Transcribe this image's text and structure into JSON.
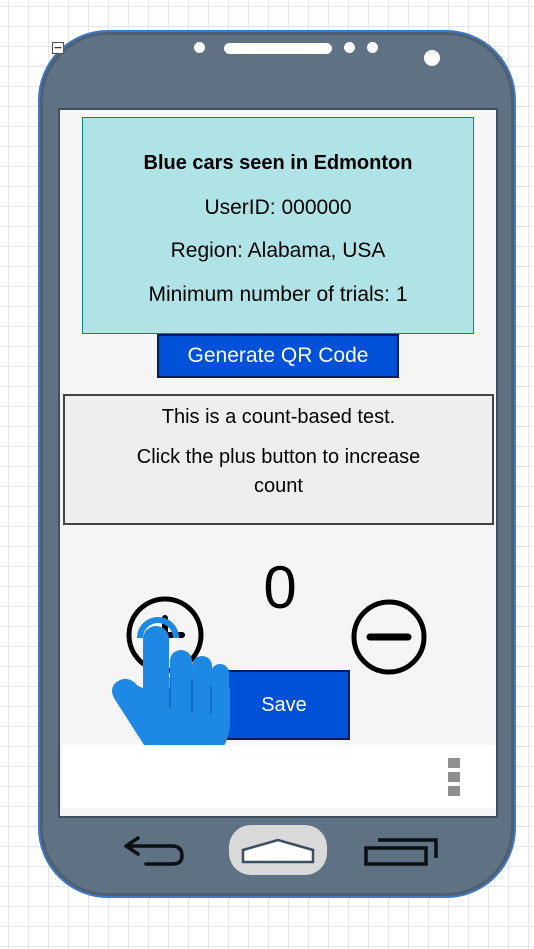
{
  "card": {
    "title": "Blue cars seen in Edmonton",
    "user_id": "UserID: 000000",
    "region": "Region: Alabama, USA",
    "min_trials": "Minimum number of trials: 1"
  },
  "qr_button": {
    "label": "Generate QR Code"
  },
  "instructions": {
    "line1": "This is a count-based test.",
    "line2": "Click the plus button to increase",
    "line3": "count"
  },
  "counter": {
    "value": "0",
    "increment_icon": "plus-circle-icon",
    "decrement_icon": "minus-circle-icon"
  },
  "save_button": {
    "label": "Save"
  },
  "icons": {
    "pointer": "hand-pointer-icon",
    "overflow_menu": "overflow-menu-icon",
    "back": "back-arrow-icon",
    "home": "home-icon",
    "recents": "recent-apps-icon"
  },
  "colors": {
    "phone_body": "#5f7284",
    "card_background": "#b0e3e6",
    "card_border": "#0e8088",
    "button_blue": "#0050d8",
    "hand_blue": "#1e88e5"
  }
}
